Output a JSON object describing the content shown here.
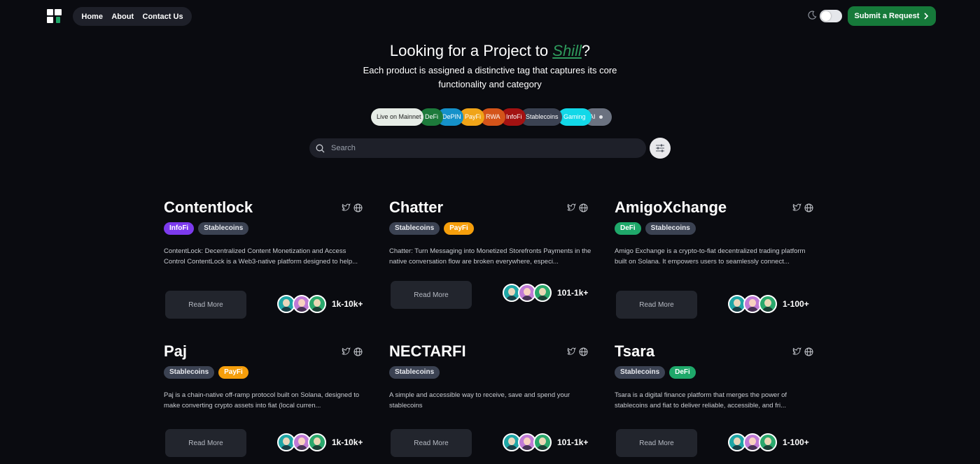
{
  "header": {
    "nav": [
      "Home",
      "About",
      "Contact Us"
    ],
    "submit_label": "Submit a Request"
  },
  "hero": {
    "title_prefix": "Looking for a Project to ",
    "title_accent": "Shill",
    "title_suffix": "?",
    "subtitle": "Each product is assigned a distinctive tag that captures its core functionality and category"
  },
  "filter_tags": [
    {
      "label": "Live on Mainnet",
      "color": "#e6ece6",
      "text": "#222222"
    },
    {
      "label": "DeFi",
      "color": "#1d7a3b",
      "text": "#ffffff"
    },
    {
      "label": "DePIN",
      "color": "#1591c9",
      "text": "#ffffff"
    },
    {
      "label": "PayFi",
      "color": "#f0a418",
      "text": "#ffffff"
    },
    {
      "label": "RWA",
      "color": "#d4541a",
      "text": "#ffffff"
    },
    {
      "label": "InfoFi",
      "color": "#a31212",
      "text": "#ffffff"
    },
    {
      "label": "Stablecoins",
      "color": "#3b4252",
      "text": "#ffffff"
    },
    {
      "label": "Gaming",
      "color": "#12d8e8",
      "text": "#ffffff"
    },
    {
      "label": "AI",
      "color": "#6b7280",
      "text": "#ffffff"
    }
  ],
  "search": {
    "placeholder": "Search"
  },
  "badge_colors": {
    "InfoFi": "#7c3aed",
    "Stablecoins": "#3b4252",
    "PayFi": "#f59e0b",
    "DeFi": "#1fa86a"
  },
  "projects": [
    {
      "name": "Contentlock",
      "tags": [
        "InfoFi",
        "Stablecoins"
      ],
      "description": "ContentLock: Decentralized Content Monetization and Access Control ContentLock is a Web3-native platform designed to help...",
      "read_more": "Read More",
      "range": "1k-10k+"
    },
    {
      "name": "Chatter",
      "tags": [
        "Stablecoins",
        "PayFi"
      ],
      "description": "Chatter: Turn Messaging into Monetized Storefronts Payments in the native conversation flow are broken everywhere, especi...",
      "read_more": "Read More",
      "range": "101-1k+"
    },
    {
      "name": "AmigoXchange",
      "tags": [
        "DeFi",
        "Stablecoins"
      ],
      "description": "Amigo Exchange is a crypto-to-fiat decentralized trading platform built on Solana. It empowers users to seamlessly connect...",
      "read_more": "Read More",
      "range": "1-100+"
    },
    {
      "name": "Paj",
      "tags": [
        "Stablecoins",
        "PayFi"
      ],
      "description": "Paj is a chain-native off-ramp protocol built on Solana, designed to make converting crypto assets into fiat (local curren...",
      "read_more": "Read More",
      "range": "1k-10k+"
    },
    {
      "name": "NECTARFI",
      "tags": [
        "Stablecoins"
      ],
      "description": "A simple and accessible way to receive, save and spend your stablecoins",
      "read_more": "Read More",
      "range": "101-1k+"
    },
    {
      "name": "Tsara",
      "tags": [
        "Stablecoins",
        "DeFi"
      ],
      "description": "Tsara is a digital finance platform that merges the power of stablecoins and fiat to deliver reliable, accessible, and fri...",
      "read_more": "Read More",
      "range": "1-100+"
    }
  ]
}
